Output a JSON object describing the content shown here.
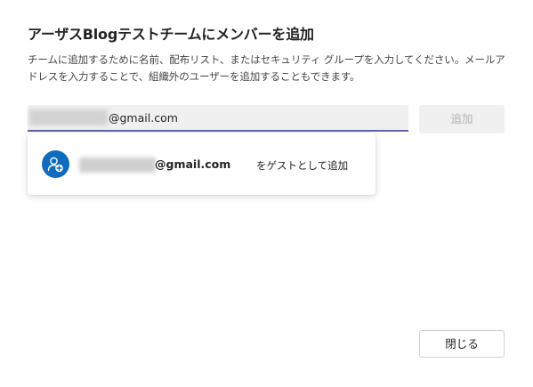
{
  "dialog": {
    "title": "アーザスBlogテストチームにメンバーを追加",
    "description": "チームに追加するために名前、配布リスト、またはセキュリティ グループを入力してください。メールアドレスを入力することで、組織外のユーザーを追加することもできます。"
  },
  "input": {
    "value_visible": "@gmail.com"
  },
  "buttons": {
    "add_label": "追加",
    "close_label": "閉じる"
  },
  "suggestion": {
    "email_visible": "@gmail.com",
    "suffix": " をゲストとして追加",
    "icon": "add-guest-icon"
  },
  "colors": {
    "accent": "#6264a7",
    "avatar": "#0f6cbd",
    "disabled_bg": "#f0f0f0",
    "disabled_text": "#c8c6c4"
  }
}
